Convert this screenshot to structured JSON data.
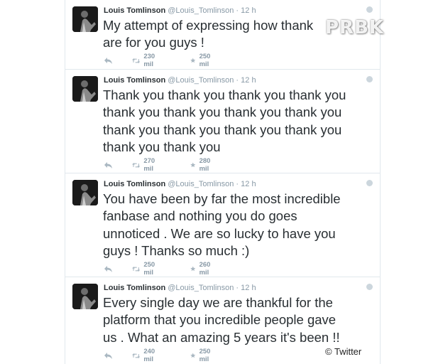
{
  "tweets": [
    {
      "author": "Louis Tomlinson",
      "handle": "@Louis_Tomlinson",
      "time": "12 h",
      "text": "My attempt of expressing how thank",
      "text2": "are for you guys !",
      "retweets": "230 mil",
      "favorites": "250 mil"
    },
    {
      "author": "Louis Tomlinson",
      "handle": "@Louis_Tomlinson",
      "time": "12 h",
      "text": "Thank you thank you thank you thank you\nthank you thank you thank you thank you\nthank you thank you thank you thank you\nthank you thank you",
      "retweets": "270 mil",
      "favorites": "280 mil"
    },
    {
      "author": "Louis Tomlinson",
      "handle": "@Louis_Tomlinson",
      "time": "12 h",
      "text": "You have been by far the most incredible\nfanbase and nothing you do goes\nunnoticed . We are so lucky to have you\nguys ! Thanks so much :)",
      "retweets": "250 mil",
      "favorites": "260 mil"
    },
    {
      "author": "Louis Tomlinson",
      "handle": "@Louis_Tomlinson",
      "time": "12 h",
      "text": "Every single day we are thankful for the\nplatform that you incredible people gave\nus . What an amazing 5 years it's been !!",
      "retweets": "240 mil",
      "favorites": "250 mil"
    }
  ],
  "separator": "·",
  "watermark": "PRBK",
  "credit": "© Twitter",
  "colors": {
    "text": "#292f33",
    "muted": "#8899a6",
    "border": "#e1e8ed"
  }
}
